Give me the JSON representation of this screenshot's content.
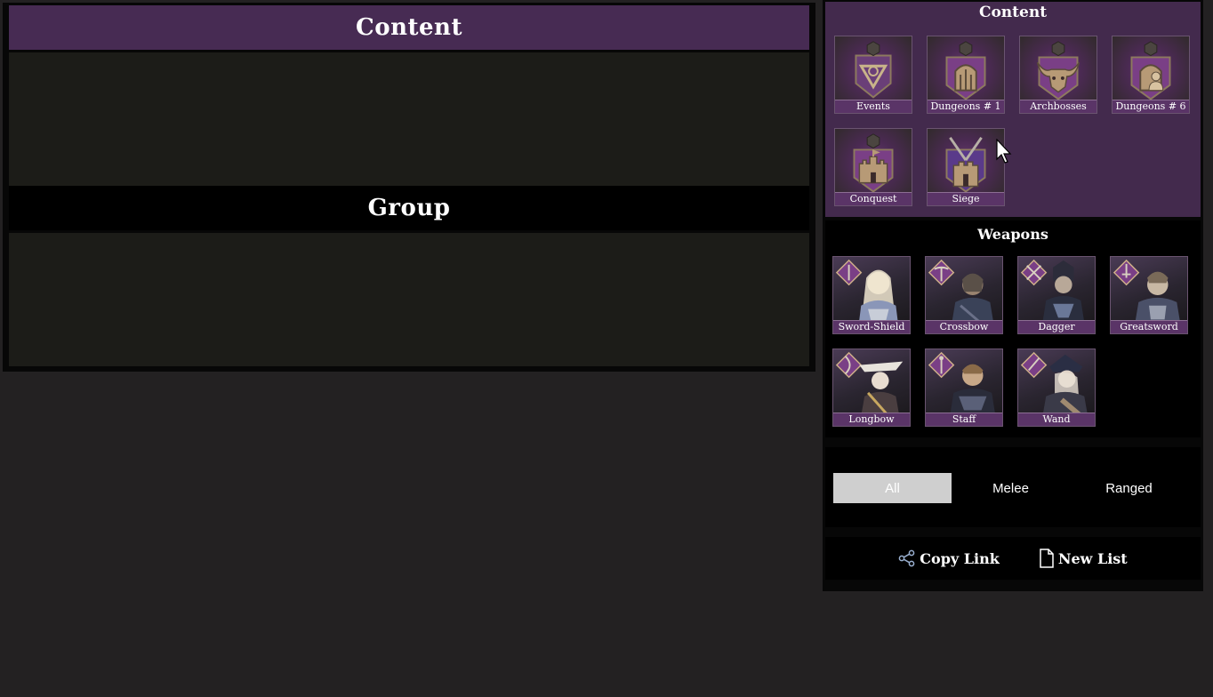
{
  "main": {
    "content_header": "Content",
    "group_header": "Group"
  },
  "sidebar": {
    "content_title": "Content",
    "content_tiles": [
      {
        "label": "Events",
        "icon": "triangle-emblem-icon"
      },
      {
        "label": "Dungeons # 1",
        "icon": "dungeon-gate-icon"
      },
      {
        "label": "Archbosses",
        "icon": "bull-skull-icon"
      },
      {
        "label": "Dungeons # 6",
        "icon": "dungeon-party-icon"
      },
      {
        "label": "Conquest",
        "icon": "castle-tower-icon"
      },
      {
        "label": "Siege",
        "icon": "siege-fortress-icon"
      }
    ],
    "weapons_title": "Weapons",
    "weapon_tiles": [
      {
        "label": "Sword-Shield",
        "icon": "sword-shield-icon"
      },
      {
        "label": "Crossbow",
        "icon": "crossbow-icon"
      },
      {
        "label": "Dagger",
        "icon": "dagger-icon"
      },
      {
        "label": "Greatsword",
        "icon": "greatsword-icon"
      },
      {
        "label": "Longbow",
        "icon": "longbow-icon"
      },
      {
        "label": "Staff",
        "icon": "staff-icon"
      },
      {
        "label": "Wand",
        "icon": "wand-icon"
      }
    ],
    "filters": [
      {
        "label": "All",
        "active": true
      },
      {
        "label": "Melee",
        "active": false
      },
      {
        "label": "Ranged",
        "active": false
      }
    ],
    "actions": {
      "copy_link": "Copy Link",
      "new_list": "New List"
    }
  },
  "colors": {
    "page_bg": "#232122",
    "header_purple": "#472b53",
    "content_section_bg": "#432a4d",
    "label_purple": "#5a3467",
    "active_filter_bg": "#cfcfcf",
    "empty_box": "#1c1c18"
  }
}
